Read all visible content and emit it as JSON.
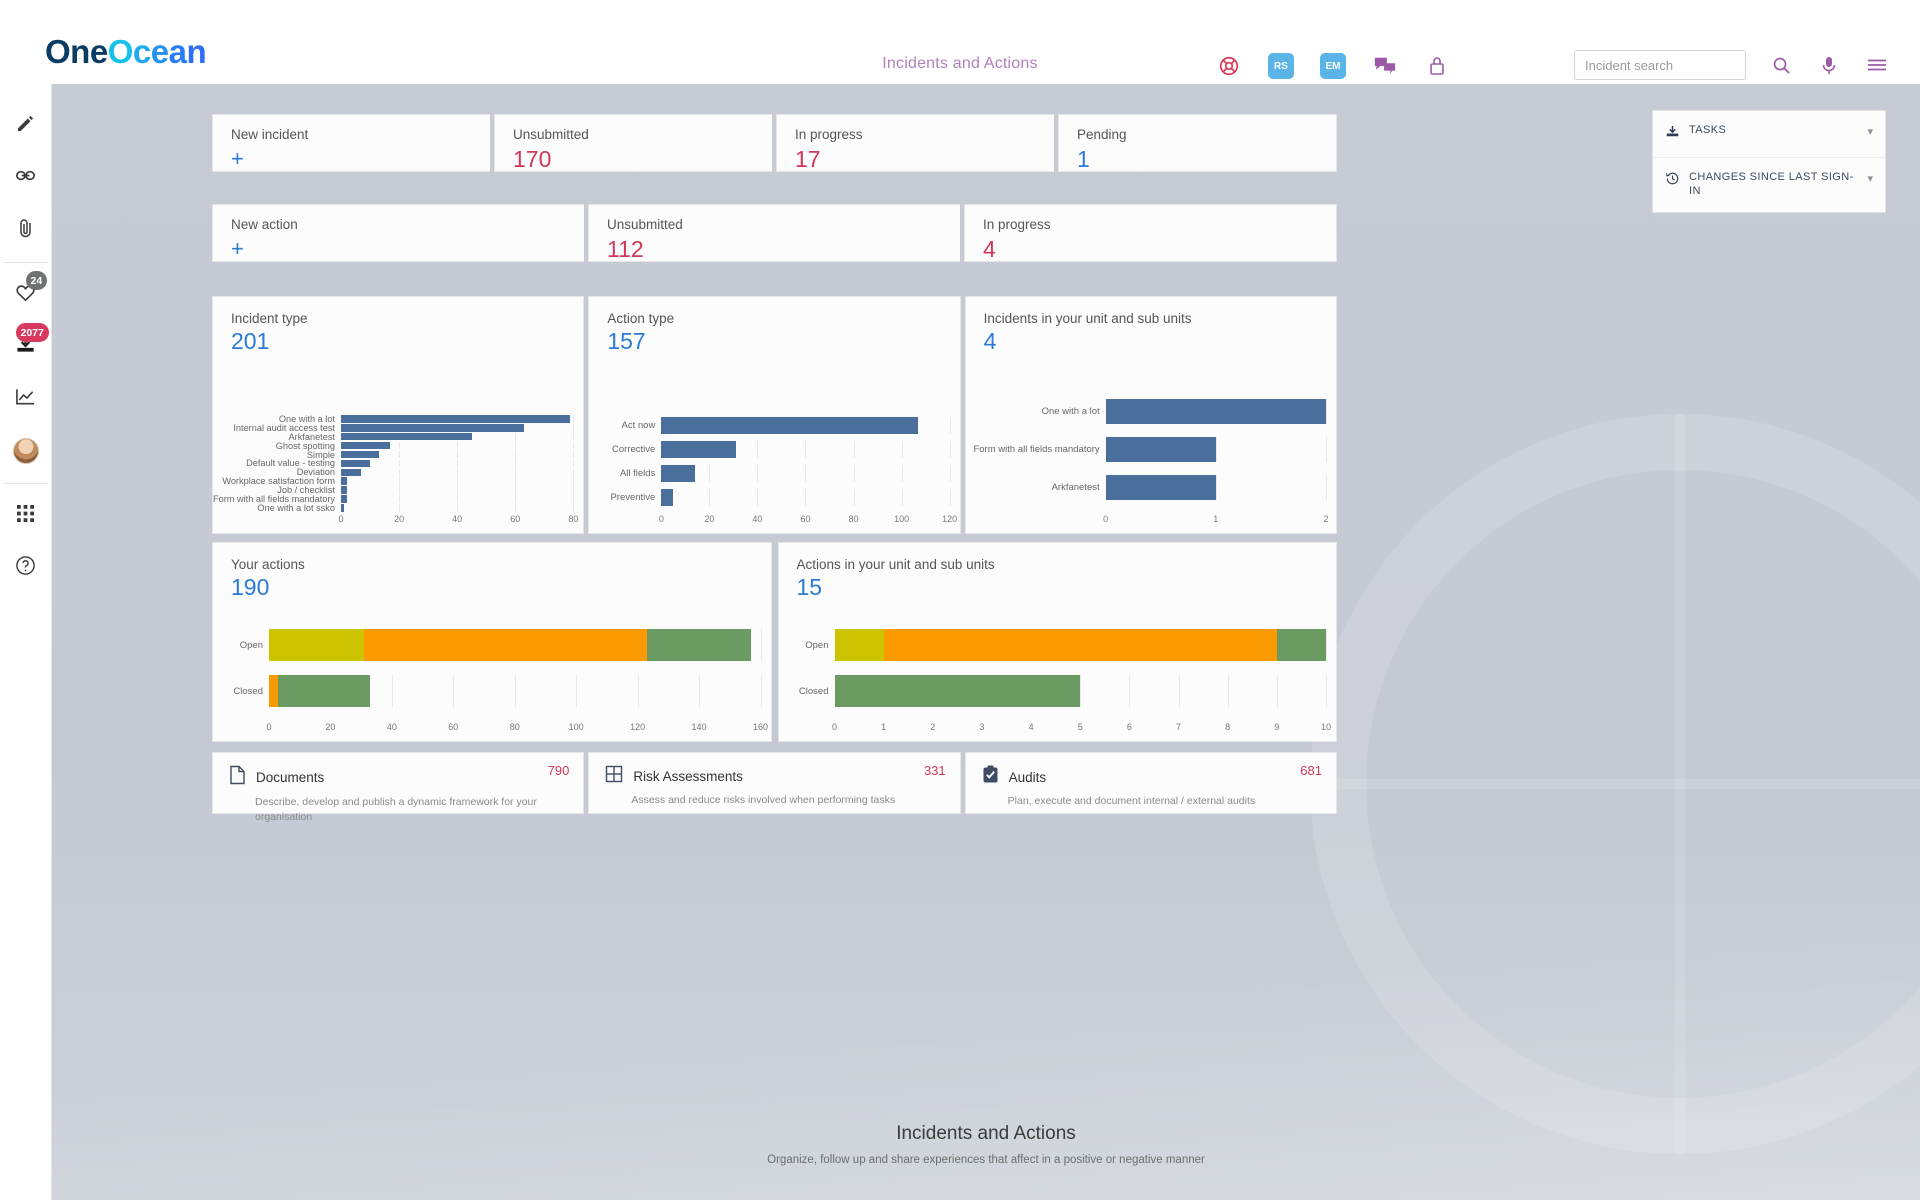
{
  "header": {
    "logo_one": "One",
    "logo_ocean": "Ocean",
    "page_title": "Incidents and Actions",
    "icons": [
      "lifebuoy-icon",
      "chat-icon",
      "lock-icon"
    ],
    "badges": [
      {
        "label": "RS"
      },
      {
        "label": "EM"
      }
    ],
    "search": {
      "placeholder": "Incident search",
      "value": ""
    },
    "tools": [
      "search-icon",
      "microphone-icon",
      "menu-icon"
    ]
  },
  "sidebar": {
    "items": [
      {
        "icon": "pencil-icon",
        "badge": ""
      },
      {
        "icon": "link-icon",
        "badge": ""
      },
      {
        "icon": "paperclip-icon",
        "badge": ""
      },
      {
        "icon": "heart-icon",
        "badge": "24"
      },
      {
        "icon": "inbox-download-icon",
        "badge": "2077"
      },
      {
        "icon": "chart-line-icon",
        "badge": ""
      },
      {
        "icon": "avatar",
        "badge": ""
      },
      {
        "icon": "grid-apps-icon",
        "badge": ""
      },
      {
        "icon": "help-circle-icon",
        "badge": ""
      }
    ]
  },
  "incident_stats": [
    {
      "label": "New incident",
      "value": "+",
      "kind": "plus"
    },
    {
      "label": "Unsubmitted",
      "value": "170",
      "kind": "red"
    },
    {
      "label": "In progress",
      "value": "17",
      "kind": "red"
    },
    {
      "label": "Pending",
      "value": "1",
      "kind": "blue"
    }
  ],
  "action_stats": [
    {
      "label": "New action",
      "value": "+",
      "kind": "plus"
    },
    {
      "label": "Unsubmitted",
      "value": "112",
      "kind": "red"
    },
    {
      "label": "In progress",
      "value": "4",
      "kind": "red"
    }
  ],
  "chart_data": [
    {
      "type": "bar",
      "orientation": "horizontal",
      "title": "Incident type",
      "total": "201",
      "xlabel": "",
      "ylabel": "",
      "xlim": [
        0,
        80
      ],
      "ticks": [
        0,
        20,
        40,
        60,
        80
      ],
      "grid": true,
      "bar_color": "#4a6f9c",
      "categories": [
        "One with a lot",
        "Internal audit access test",
        "Arkfanetest",
        "Ghost spotting",
        "Simple",
        "Default value - testing",
        "Deviation",
        "Workplace satisfaction form",
        "Job / checklist",
        "Form with all fields mandatory",
        "One with a lot ssko"
      ],
      "values": [
        79,
        63,
        45,
        17,
        13,
        10,
        7,
        2,
        2,
        2,
        1
      ]
    },
    {
      "type": "bar",
      "orientation": "horizontal",
      "title": "Action type",
      "total": "157",
      "xlabel": "",
      "ylabel": "",
      "xlim": [
        0,
        120
      ],
      "ticks": [
        0,
        20,
        40,
        60,
        80,
        100,
        120
      ],
      "grid": true,
      "bar_color": "#4a6f9c",
      "categories": [
        "Act now",
        "Corrective",
        "All fields",
        "Preventive"
      ],
      "values": [
        107,
        31,
        14,
        5
      ]
    },
    {
      "type": "bar",
      "orientation": "horizontal",
      "title": "Incidents in your unit and sub units",
      "total": "4",
      "xlabel": "",
      "ylabel": "",
      "xlim": [
        0,
        2
      ],
      "ticks": [
        0,
        1,
        2
      ],
      "grid": true,
      "bar_color": "#4a6f9c",
      "categories": [
        "One with a lot",
        "Form with all fields mandatory",
        "Arkfanetest"
      ],
      "values": [
        2,
        1,
        1
      ]
    },
    {
      "type": "bar",
      "orientation": "horizontal",
      "stacked": true,
      "title": "Your actions",
      "total": "190",
      "xlim": [
        0,
        160
      ],
      "ticks": [
        0,
        20,
        40,
        60,
        80,
        100,
        120,
        140,
        160
      ],
      "grid": true,
      "categories": [
        "Open",
        "Closed"
      ],
      "series": [
        {
          "name": "yellow",
          "color": "#ccc400",
          "values": [
            31,
            0
          ]
        },
        {
          "name": "orange",
          "color": "#fb9a00",
          "values": [
            92,
            3
          ]
        },
        {
          "name": "green",
          "color": "#6b9a62",
          "values": [
            34,
            30
          ]
        }
      ]
    },
    {
      "type": "bar",
      "orientation": "horizontal",
      "stacked": true,
      "title": "Actions in your unit and sub units",
      "total": "15",
      "xlim": [
        0,
        10
      ],
      "ticks": [
        0,
        1,
        2,
        3,
        4,
        5,
        6,
        7,
        8,
        9,
        10
      ],
      "grid": true,
      "categories": [
        "Open",
        "Closed"
      ],
      "series": [
        {
          "name": "yellow",
          "color": "#ccc400",
          "values": [
            1,
            0
          ]
        },
        {
          "name": "orange",
          "color": "#fb9a00",
          "values": [
            8,
            0
          ]
        },
        {
          "name": "green",
          "color": "#6b9a62",
          "values": [
            1,
            5
          ]
        }
      ]
    }
  ],
  "link_cards": [
    {
      "icon": "document-icon",
      "title": "Documents",
      "desc": "Describe, develop and publish a dynamic framework for your organisation",
      "count": "790"
    },
    {
      "icon": "grid-table-icon",
      "title": "Risk Assessments",
      "desc": "Assess and reduce risks involved when performing tasks",
      "count": "331"
    },
    {
      "icon": "clipboard-check-icon",
      "title": "Audits",
      "desc": "Plan, execute and document internal / external audits",
      "count": "681"
    }
  ],
  "tasks_panel": [
    {
      "icon": "inbox-download-icon",
      "label": "TASKS"
    },
    {
      "icon": "history-clock-icon",
      "label": "CHANGES SINCE LAST SIGN-IN"
    }
  ],
  "footer": {
    "title": "Incidents and Actions",
    "subtitle": "Organize, follow up and share experiences that affect in a positive or negative manner"
  }
}
